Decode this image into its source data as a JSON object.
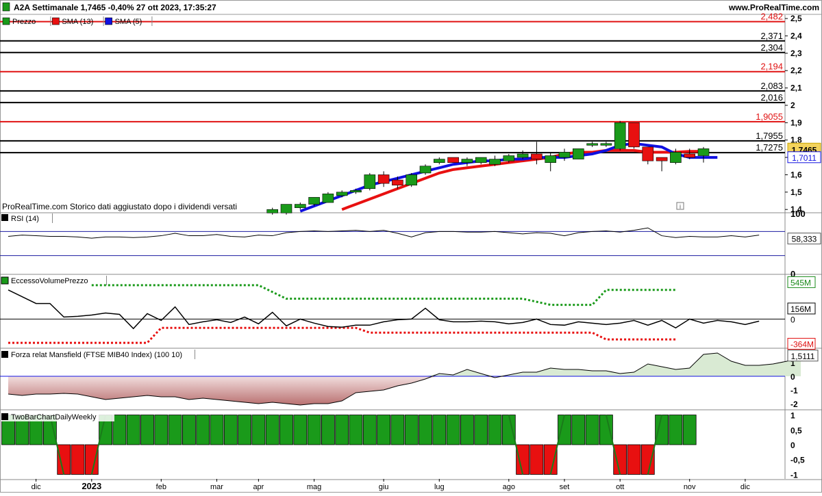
{
  "header": {
    "title": "A2A Settimanale 1,7465 -0,40% 27 ott 2023, 17:35:27",
    "site": "www.ProRealTime.com"
  },
  "legend": [
    {
      "label": "Prezzo",
      "color": "#1a9a1a"
    },
    {
      "label": "SMA (13)",
      "color": "#e81010"
    },
    {
      "label": "SMA (5)",
      "color": "#1010e0"
    }
  ],
  "note": "ProRealTime.com Storico dati aggiustato dopo i dividendi versati",
  "badges": {
    "price": "1,7465",
    "sma5": "1,7011"
  },
  "colors": {
    "up": "#1a9a1a",
    "down": "#e81010",
    "sma13": "#e81010",
    "sma5": "#1010e0",
    "rsi_band": "#1a1aa0",
    "dotted_green": "#1a9a1a",
    "dotted_red": "#e81010",
    "mansfield_pos": "#d9ead3",
    "mansfield_neg": "#b97070"
  },
  "x_axis": {
    "labels": [
      {
        "text": "dic",
        "week": 2
      },
      {
        "text": "2023",
        "week": 6
      },
      {
        "text": "feb",
        "week": 11
      },
      {
        "text": "mar",
        "week": 15
      },
      {
        "text": "apr",
        "week": 18
      },
      {
        "text": "mag",
        "week": 22
      },
      {
        "text": "giu",
        "week": 27
      },
      {
        "text": "lug",
        "week": 31
      },
      {
        "text": "ago",
        "week": 36
      },
      {
        "text": "set",
        "week": 40
      },
      {
        "text": "ott",
        "week": 44
      },
      {
        "text": "nov",
        "week": 49
      },
      {
        "text": "dic",
        "week": 53
      }
    ]
  },
  "chart_data": [
    {
      "type": "candlestick",
      "title": "Prezzo",
      "y_ticks": [
        "2,5",
        "2,4",
        "2,3",
        "2,2",
        "2,1",
        "2",
        "1,9",
        "1,8",
        "1,7",
        "1,6",
        "1,5",
        "1,4"
      ],
      "ylim": [
        1.385,
        2.52
      ],
      "levels": [
        {
          "value": 2.482,
          "label": "2,482",
          "color": "red"
        },
        {
          "value": 2.371,
          "label": "2,371",
          "color": "black"
        },
        {
          "value": 2.304,
          "label": "2,304",
          "color": "black"
        },
        {
          "value": 2.194,
          "label": "2,194",
          "color": "red"
        },
        {
          "value": 2.083,
          "label": "2,083",
          "color": "black"
        },
        {
          "value": 2.016,
          "label": "2,016",
          "color": "black"
        },
        {
          "value": 1.9055,
          "label": "1,9055",
          "color": "red"
        },
        {
          "value": 1.7955,
          "label": "1,7955",
          "color": "black"
        },
        {
          "value": 1.7275,
          "label": "1,7275",
          "color": "black"
        }
      ],
      "candles": [
        {
          "o": 1.38,
          "h": 1.41,
          "l": 1.37,
          "c": 1.4
        },
        {
          "o": 1.38,
          "h": 1.43,
          "l": 1.37,
          "c": 1.43
        },
        {
          "o": 1.41,
          "h": 1.44,
          "l": 1.4,
          "c": 1.43
        },
        {
          "o": 1.43,
          "h": 1.47,
          "l": 1.42,
          "c": 1.47
        },
        {
          "o": 1.44,
          "h": 1.5,
          "l": 1.44,
          "c": 1.49
        },
        {
          "o": 1.48,
          "h": 1.51,
          "l": 1.47,
          "c": 1.5
        },
        {
          "o": 1.5,
          "h": 1.52,
          "l": 1.49,
          "c": 1.51
        },
        {
          "o": 1.52,
          "h": 1.61,
          "l": 1.51,
          "c": 1.6
        },
        {
          "o": 1.6,
          "h": 1.62,
          "l": 1.53,
          "c": 1.55
        },
        {
          "o": 1.57,
          "h": 1.59,
          "l": 1.52,
          "c": 1.54
        },
        {
          "o": 1.54,
          "h": 1.61,
          "l": 1.53,
          "c": 1.6
        },
        {
          "o": 1.61,
          "h": 1.66,
          "l": 1.6,
          "c": 1.65
        },
        {
          "o": 1.67,
          "h": 1.7,
          "l": 1.66,
          "c": 1.69
        },
        {
          "o": 1.7,
          "h": 1.67,
          "l": 1.67,
          "c": 1.67
        },
        {
          "o": 1.67,
          "h": 1.7,
          "l": 1.65,
          "c": 1.69
        },
        {
          "o": 1.67,
          "h": 1.7,
          "l": 1.66,
          "c": 1.7
        },
        {
          "o": 1.66,
          "h": 1.71,
          "l": 1.65,
          "c": 1.69
        },
        {
          "o": 1.68,
          "h": 1.72,
          "l": 1.67,
          "c": 1.71
        },
        {
          "o": 1.7,
          "h": 1.74,
          "l": 1.69,
          "c": 1.72
        },
        {
          "o": 1.72,
          "h": 1.79,
          "l": 1.66,
          "c": 1.69
        },
        {
          "o": 1.67,
          "h": 1.73,
          "l": 1.62,
          "c": 1.71
        },
        {
          "o": 1.7,
          "h": 1.75,
          "l": 1.68,
          "c": 1.73
        },
        {
          "o": 1.69,
          "h": 1.75,
          "l": 1.69,
          "c": 1.75
        },
        {
          "o": 1.77,
          "h": 1.79,
          "l": 1.76,
          "c": 1.78
        },
        {
          "o": 1.77,
          "h": 1.79,
          "l": 1.76,
          "c": 1.78
        },
        {
          "o": 1.75,
          "h": 1.91,
          "l": 1.74,
          "c": 1.9
        },
        {
          "o": 1.9,
          "h": 1.9,
          "l": 1.75,
          "c": 1.76
        },
        {
          "o": 1.76,
          "h": 1.76,
          "l": 1.66,
          "c": 1.68
        },
        {
          "o": 1.7,
          "h": 1.7,
          "l": 1.62,
          "c": 1.68
        },
        {
          "o": 1.67,
          "h": 1.75,
          "l": 1.66,
          "c": 1.73
        },
        {
          "o": 1.72,
          "h": 1.75,
          "l": 1.69,
          "c": 1.7
        },
        {
          "o": 1.71,
          "h": 1.76,
          "l": 1.67,
          "c": 1.75
        }
      ],
      "candle_start_week": 19,
      "sma13": {
        "start_week": 24,
        "values": [
          1.4,
          1.43,
          1.46,
          1.49,
          1.52,
          1.55,
          1.58,
          1.61,
          1.63,
          1.64,
          1.65,
          1.66,
          1.67,
          1.68,
          1.69,
          1.7,
          1.72,
          1.73,
          1.73,
          1.74,
          1.74,
          1.74,
          1.73,
          1.73,
          1.73,
          1.735,
          1.735
        ]
      },
      "sma5": {
        "start_week": 21,
        "values": [
          1.39,
          1.42,
          1.45,
          1.48,
          1.51,
          1.54,
          1.56,
          1.58,
          1.6,
          1.62,
          1.64,
          1.66,
          1.67,
          1.68,
          1.68,
          1.69,
          1.69,
          1.7,
          1.7,
          1.7,
          1.71,
          1.72,
          1.74,
          1.77,
          1.78,
          1.77,
          1.76,
          1.72,
          1.7,
          1.7,
          1.7
        ]
      }
    },
    {
      "type": "line",
      "title": "RSI (14)",
      "value_label": "58,333",
      "y_ticks": [
        "100",
        "50",
        "0"
      ],
      "ylim": [
        0,
        100
      ],
      "bands": [
        70,
        30
      ],
      "x_start_week": 0,
      "values": [
        62,
        64,
        63,
        62,
        62,
        61,
        59,
        61,
        61,
        60,
        61,
        63,
        67,
        63,
        63,
        65,
        62,
        61,
        64,
        63,
        68,
        70,
        71,
        70,
        71,
        72,
        70,
        72,
        67,
        61,
        68,
        70,
        70,
        69,
        69,
        70,
        68,
        66,
        68,
        67,
        63,
        68,
        70,
        71,
        69,
        72,
        76,
        63,
        60,
        62,
        61,
        61,
        63,
        61,
        64
      ]
    },
    {
      "type": "line",
      "title": "EccessoVolumePrezzo",
      "y_ticks": [
        "545M",
        "156M",
        "0",
        "-364M"
      ],
      "ylim": [
        -420,
        650
      ],
      "value_labels": [
        {
          "v": 545,
          "text": "545M",
          "color": "green"
        },
        {
          "v": 156,
          "text": "156M",
          "color": "black"
        },
        {
          "v": 0,
          "text": "0",
          "color": "black"
        },
        {
          "v": -364,
          "text": "-364M",
          "color": "red"
        }
      ],
      "x_start_week": 0,
      "values": [
        430,
        20,
        -60,
        -30,
        -10,
        -20,
        -30,
        -10,
        -20,
        0,
        180,
        230,
        -120,
        20,
        -120,
        -20,
        -60,
        10,
        0,
        -60,
        20,
        -10,
        -20,
        -70,
        -30,
        -40,
        130,
        160,
        -60,
        -40,
        -20,
        150,
        190,
        -20,
        -90,
        20,
        -10,
        -20,
        -60,
        -70,
        -150,
        -30,
        -70,
        -120,
        -280,
        -310,
        -300,
        -280,
        -320,
        -320,
        -290,
        -260,
        -240,
        -240,
        -200
      ],
      "line_values": [
        430,
        330,
        230,
        230,
        30,
        40,
        60,
        90,
        70,
        -140,
        80,
        -20,
        180,
        -80,
        -40,
        -10,
        -50,
        30,
        -70,
        100,
        -100,
        0,
        -60,
        -110,
        -120,
        -90,
        -90,
        -40,
        -10,
        0,
        160,
        -10,
        -40,
        -40,
        -30,
        -40,
        -70,
        -50,
        0,
        -80,
        -90,
        -40,
        -60,
        -80,
        -60,
        -20,
        -90,
        -20,
        -130,
        0,
        -60,
        -20,
        -40,
        -80,
        -30
      ],
      "upper_dotted": [
        {
          "w": 6,
          "v": 500
        },
        {
          "w": 18,
          "v": 500
        },
        {
          "w": 20,
          "v": 300
        },
        {
          "w": 37,
          "v": 300
        },
        {
          "w": 39,
          "v": 210
        },
        {
          "w": 42,
          "v": 210
        },
        {
          "w": 43,
          "v": 430
        },
        {
          "w": 48,
          "v": 430
        }
      ],
      "lower_dotted": [
        {
          "w": 0,
          "v": -350
        },
        {
          "w": 10,
          "v": -350
        },
        {
          "w": 11,
          "v": -130
        },
        {
          "w": 25,
          "v": -130
        },
        {
          "w": 26,
          "v": -200
        },
        {
          "w": 42,
          "v": -200
        },
        {
          "w": 43,
          "v": -300
        },
        {
          "w": 48,
          "v": -300
        }
      ]
    },
    {
      "type": "area",
      "title": "Forza relat Mansfield (FTSE MIB40 Index) (100 10)",
      "value_label": "1,5111",
      "y_ticks": [
        "1",
        "0",
        "-1",
        "-2"
      ],
      "ylim": [
        -2.4,
        2.0
      ],
      "x_start_week": 0,
      "values": [
        -1.3,
        -1.4,
        -1.3,
        -1.3,
        -1.25,
        -1.3,
        -1.5,
        -1.7,
        -1.6,
        -1.5,
        -1.4,
        -1.5,
        -1.5,
        -1.7,
        -1.6,
        -1.7,
        -1.8,
        -1.9,
        -2.0,
        -1.9,
        -2.0,
        -2.1,
        -2.0,
        -2.0,
        -1.8,
        -1.2,
        -1.1,
        -1.0,
        -0.7,
        -0.5,
        -0.2,
        0.2,
        0.1,
        0.5,
        0.2,
        -0.1,
        0.1,
        0.3,
        0.3,
        0.6,
        0.5,
        0.5,
        0.4,
        0.4,
        0.2,
        0.3,
        0.9,
        0.7,
        0.5,
        0.6,
        1.6,
        1.7,
        1.1,
        0.8,
        0.8,
        0.9,
        1.1,
        1.5
      ]
    },
    {
      "type": "bar",
      "title": "TwoBarChartDailyWeekly",
      "y_ticks": [
        "1",
        "0,5",
        "0",
        "-0,5",
        "-1"
      ],
      "ylim": [
        -1.15,
        1.15
      ],
      "values": [
        1,
        1,
        1,
        1,
        -1,
        -1,
        -1,
        1,
        1,
        1,
        1,
        1,
        1,
        1,
        1,
        1,
        1,
        1,
        1,
        1,
        1,
        1,
        1,
        1,
        1,
        1,
        1,
        1,
        1,
        1,
        1,
        1,
        1,
        1,
        1,
        1,
        1,
        -1,
        -1,
        -1,
        1,
        1,
        1,
        1,
        -1,
        -1,
        -1,
        1,
        1,
        1
      ]
    }
  ]
}
